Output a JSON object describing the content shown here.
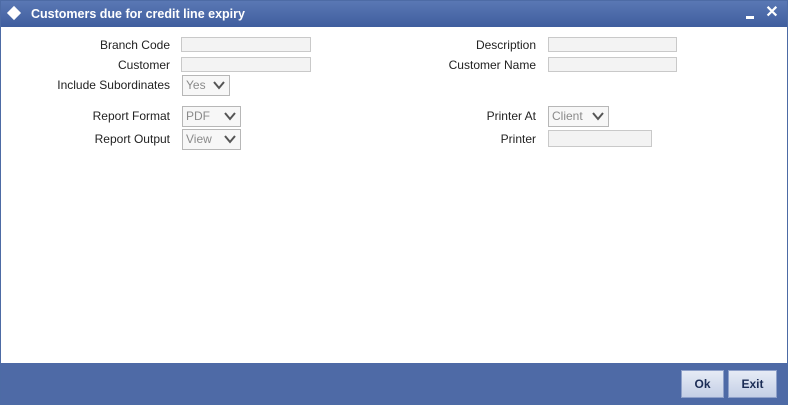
{
  "window": {
    "title": "Customers due for credit line expiry",
    "close_glyph": "✕"
  },
  "form": {
    "branch_code": {
      "label": "Branch Code",
      "value": ""
    },
    "description": {
      "label": "Description",
      "value": ""
    },
    "customer": {
      "label": "Customer",
      "value": ""
    },
    "customer_name": {
      "label": "Customer Name",
      "value": ""
    },
    "include_subordinates": {
      "label": "Include Subordinates",
      "value": "Yes"
    },
    "report_format": {
      "label": "Report Format",
      "value": "PDF"
    },
    "printer_at": {
      "label": "Printer At",
      "value": "Client"
    },
    "report_output": {
      "label": "Report Output",
      "value": "View"
    },
    "printer": {
      "label": "Printer",
      "value": ""
    }
  },
  "footer": {
    "ok_label": "Ok",
    "exit_label": "Exit"
  },
  "colors": {
    "titlebar": "#4a6aa9",
    "footer": "#4e6aa6",
    "field_bg": "#f3f3f3"
  },
  "icons": [
    "diamond-icon",
    "minimize-icon",
    "close-icon",
    "chevron-down-icon"
  ]
}
